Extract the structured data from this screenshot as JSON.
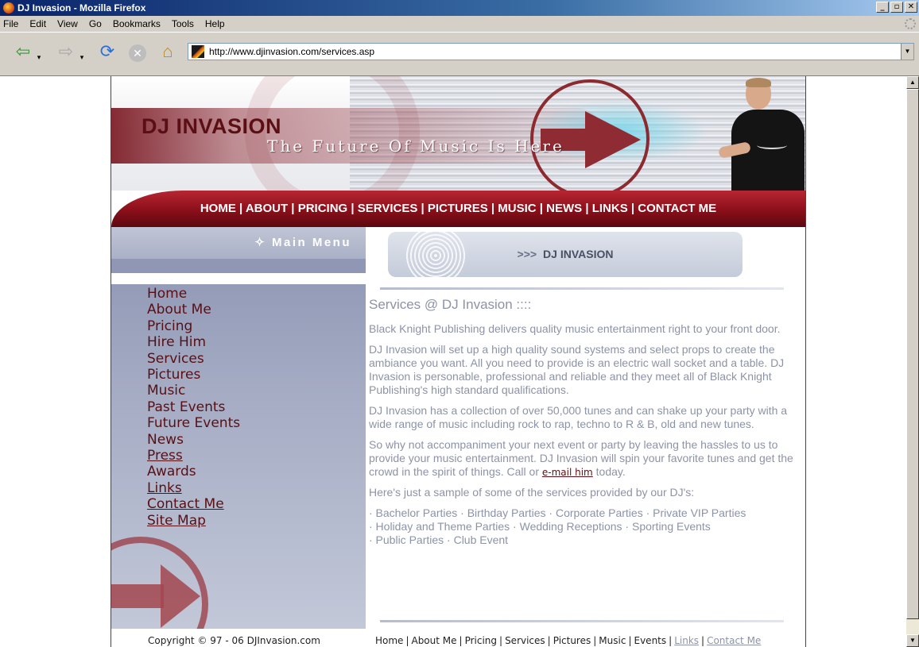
{
  "window": {
    "title": "DJ Invasion - Mozilla Firefox"
  },
  "menubar": [
    "File",
    "Edit",
    "View",
    "Go",
    "Bookmarks",
    "Tools",
    "Help"
  ],
  "urlbar": {
    "url": "http://www.djinvasion.com/services.asp"
  },
  "banner": {
    "logo": "DJ INVASION",
    "tagline": "The Future Of Music Is Here"
  },
  "topnav": [
    "HOME ",
    "ABOUT",
    "PRICING",
    "SERVICES",
    "PICTURES",
    "MUSIC",
    "NEWS",
    "LINKS",
    "CONTACT ME"
  ],
  "sidebar": {
    "heading": "✧ Main Menu",
    "items": [
      "Home",
      "About Me",
      "Pricing",
      "Hire Him",
      "Services",
      "Pictures",
      "Music",
      "Past Events",
      "Future Events",
      "News",
      "Press",
      "Awards",
      "Links",
      "Contact Me",
      "Site Map"
    ]
  },
  "main": {
    "bar_chevrons": ">>>",
    "bar_label": "DJ INVASION",
    "heading": "Services @ DJ Invasion ::::",
    "p1": "Black Knight Publishing delivers quality music entertainment right to your front door.",
    "p2": "DJ Invasion will set up a high quality sound systems and select props to create the ambiance you want. All you need to provide is an electric wall socket and a table. DJ Invasion is personable, professional and reliable and they meet all of Black Knight Publishing's high standard qualifications.",
    "p3": "DJ Invasion has a collection of over 50,000 tunes and can shake up your party with a wide range of music including rock to rap, techno to R & B, old and new tunes.",
    "p4_start": "So why not accompaniment your next event or party by leaving the hassles to us to provide your music entertainment. DJ Invasion will spin your favorite tunes and get the crowd in the spirit of things. Call or ",
    "p4_link": "e-mail him",
    "p4_end": " today.",
    "p5": "Here's just a sample of some of the services provided by our DJ's:",
    "services_line1": "· Bachelor Parties · Birthday Parties · Corporate Parties · Private VIP Parties",
    "services_line2": "· Holiday and Theme Parties · Wedding Receptions · Sporting Events",
    "services_line3": "· Public Parties · Club Event"
  },
  "footer": {
    "copyright": "Copyright © 97 - 06 DJInvasion.com",
    "links": [
      "Home",
      "About Me",
      "Pricing",
      "Services",
      "Pictures",
      "Music",
      "Events",
      "Links",
      "Contact Me"
    ]
  }
}
